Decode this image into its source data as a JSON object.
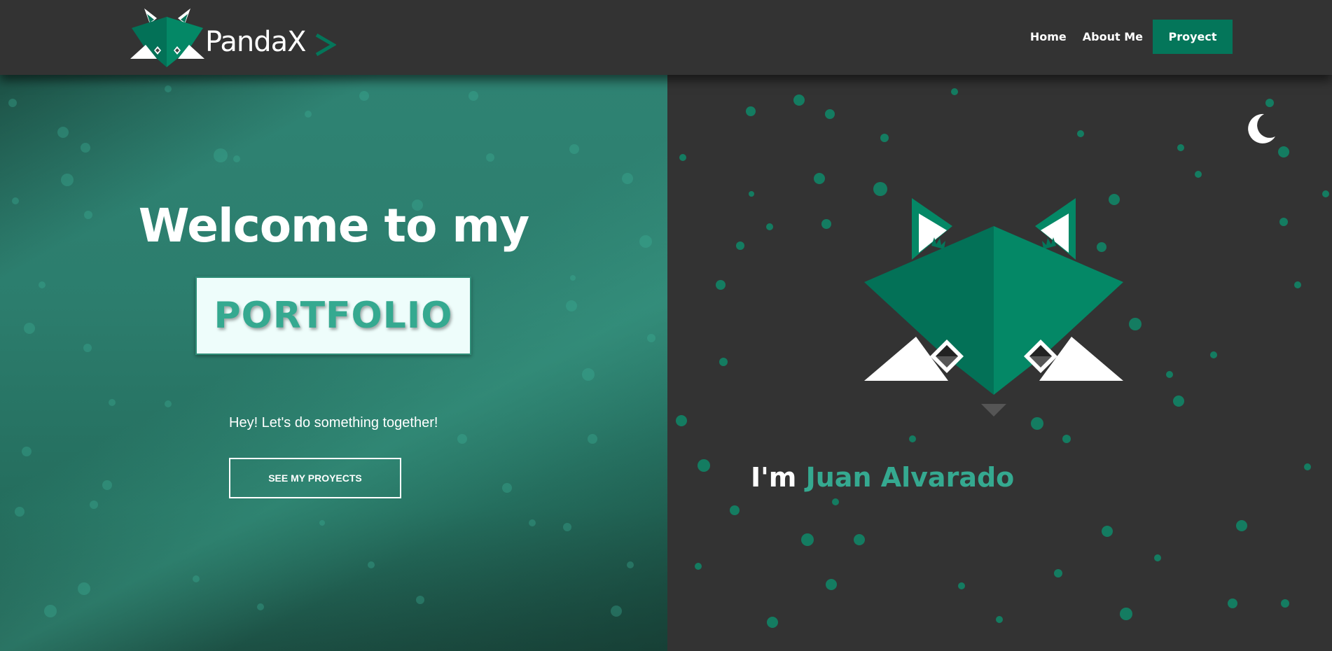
{
  "colors": {
    "accent": "#35a990",
    "brand_green": "#04765a",
    "dark_bg": "#333333",
    "hero_green": "#2c7d6d"
  },
  "header": {
    "brand_name": "PandaX",
    "nav": [
      {
        "label": "Home"
      },
      {
        "label": "About Me"
      },
      {
        "label": "Proyect"
      }
    ]
  },
  "hero": {
    "welcome": "Welcome to my",
    "portfolio": "PORTFOLIO",
    "tagline": "Hey! Let's do something together!",
    "cta": "SEE MY PROYECTS"
  },
  "profile": {
    "greeting": "I'm",
    "name": "Juan Alvarado"
  },
  "icons": {
    "theme_toggle": "moon-icon",
    "brand_arrow": "chevron-right-icon"
  }
}
